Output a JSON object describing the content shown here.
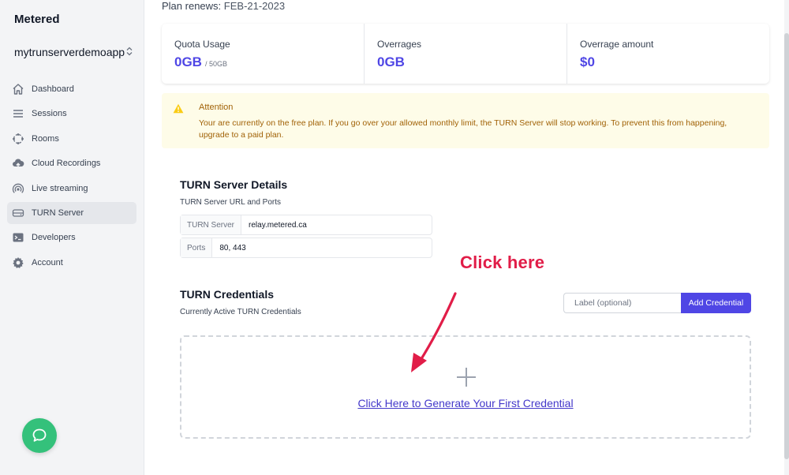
{
  "sidebar": {
    "brand": "Metered",
    "app_name": "mytrunserverdemoapp",
    "items": [
      {
        "label": "Dashboard",
        "icon": "home-icon",
        "active": false
      },
      {
        "label": "Sessions",
        "icon": "list-icon",
        "active": false
      },
      {
        "label": "Rooms",
        "icon": "rooms-icon",
        "active": false
      },
      {
        "label": "Cloud Recordings",
        "icon": "cloud-upload-icon",
        "active": false
      },
      {
        "label": "Live streaming",
        "icon": "broadcast-icon",
        "active": false
      },
      {
        "label": "TURN Server",
        "icon": "server-icon",
        "active": true
      },
      {
        "label": "Developers",
        "icon": "terminal-icon",
        "active": false
      },
      {
        "label": "Account",
        "icon": "gear-icon",
        "active": false
      }
    ]
  },
  "plan": {
    "label": "Plan renews:",
    "date": "FEB-21-2023"
  },
  "stats": [
    {
      "label": "Quota Usage",
      "value": "0GB",
      "sub": "/ 50GB"
    },
    {
      "label": "Overrages",
      "value": "0GB",
      "sub": ""
    },
    {
      "label": "Overrage amount",
      "value": "$0",
      "sub": ""
    }
  ],
  "alert": {
    "title": "Attention",
    "message": "Your are currently on the free plan. If you go over your allowed monthly limit, the TURN Server will stop working. To prevent this from happening, upgrade to a paid plan."
  },
  "turn_details": {
    "title": "TURN Server Details",
    "subtitle": "TURN Server URL and Ports",
    "server_key": "TURN Server",
    "server_value": "relay.metered.ca",
    "ports_key": "Ports",
    "ports_value": "80, 443"
  },
  "credentials": {
    "title": "TURN Credentials",
    "subtitle": "Currently Active TURN Credentials",
    "label_placeholder": "Label (optional)",
    "add_button": "Add Credential",
    "generate_link": "Click Here to Generate Your First Credential"
  },
  "annotation": {
    "text": "Click here",
    "color": "#e11d48"
  },
  "colors": {
    "accent": "#4f46e5",
    "alert_bg": "#fefce8",
    "alert_text": "#a16207",
    "chat": "#34c17b"
  }
}
